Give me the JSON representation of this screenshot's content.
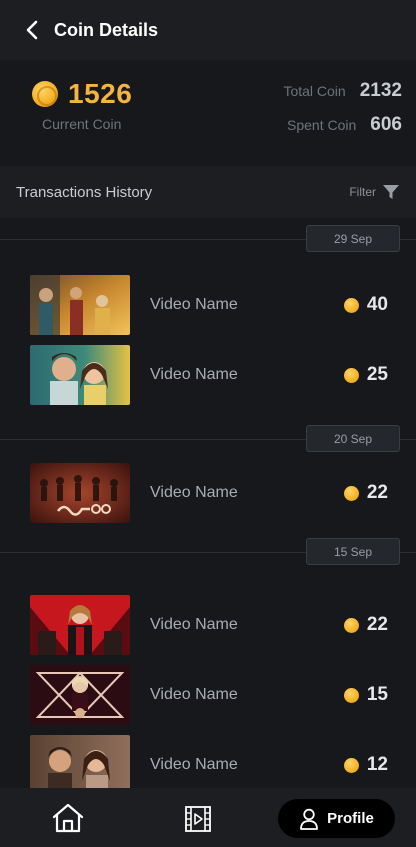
{
  "header": {
    "title": "Coin Details"
  },
  "summary": {
    "current_value": "1526",
    "current_label": "Current Coin",
    "total_label": "Total Coin",
    "total_value": "2132",
    "spent_label": "Spent Coin",
    "spent_value": "606"
  },
  "transactions": {
    "title": "Transactions History",
    "filter_label": "Filter",
    "groups": [
      {
        "date": "29 Sep",
        "items": [
          {
            "name": "Video Name",
            "coins": "40"
          },
          {
            "name": "Video Name",
            "coins": "25"
          }
        ]
      },
      {
        "date": "20 Sep",
        "items": [
          {
            "name": "Video Name",
            "coins": "22"
          }
        ]
      },
      {
        "date": "15 Sep",
        "items": [
          {
            "name": "Video Name",
            "coins": "22"
          },
          {
            "name": "Video Name",
            "coins": "15"
          },
          {
            "name": "Video Name",
            "coins": "12"
          }
        ]
      }
    ]
  },
  "bottom_nav": {
    "profile_label": "Profile"
  },
  "colors": {
    "accent_gold": "#f5b341",
    "background": "#16181c",
    "panel": "#1c1e22"
  }
}
